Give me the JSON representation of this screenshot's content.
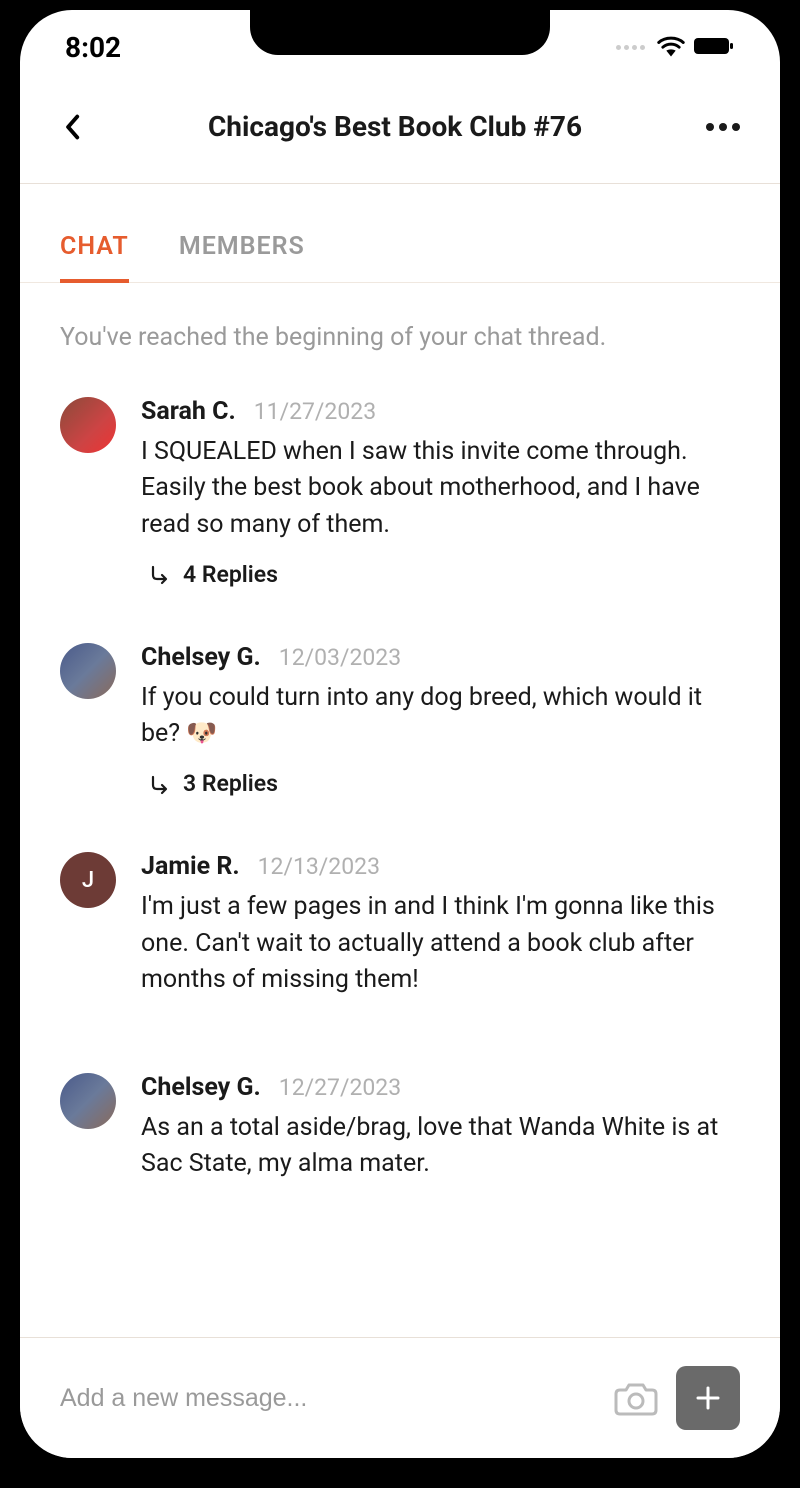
{
  "status": {
    "time": "8:02"
  },
  "header": {
    "title": "Chicago's Best Book Club #76"
  },
  "tabs": {
    "chat": "CHAT",
    "members": "MEMBERS"
  },
  "thread_begin": "You've reached the beginning of your chat thread.",
  "messages": [
    {
      "author": "Sarah C.",
      "date": "11/27/2023",
      "text": "I SQUEALED when I saw this invite come through. Easily the best book about motherhood, and I have read so many of them.",
      "replies": "4 Replies"
    },
    {
      "author": "Chelsey G.",
      "date": "12/03/2023",
      "text": "If you could turn into any dog breed, which would it be? 🐶",
      "replies": "3 Replies"
    },
    {
      "author": "Jamie R.",
      "initial": "J",
      "date": "12/13/2023",
      "text": "I'm just a few pages in and I think I'm gonna like this one. Can't wait to actually attend a book club after months of missing them!"
    },
    {
      "author": "Chelsey G.",
      "date": "12/27/2023",
      "text": "As an a total aside/brag, love that Wanda White is at Sac State, my alma mater."
    }
  ],
  "input": {
    "placeholder": "Add a new message..."
  }
}
